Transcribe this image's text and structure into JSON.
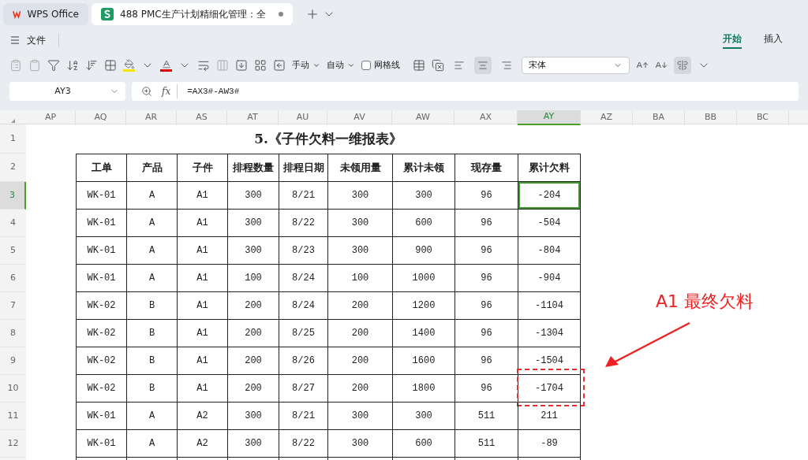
{
  "app_tabs": [
    {
      "label": "WPS Office",
      "kind": "home",
      "selected": false
    },
    {
      "label": "488 PMC生产计划精细化管理：全",
      "kind": "sheet",
      "selected": true,
      "unsaved": true
    }
  ],
  "menu": {
    "file": "文件"
  },
  "ribbon_tabs": [
    {
      "label": "开始",
      "selected": true
    },
    {
      "label": "插入",
      "selected": false
    }
  ],
  "toolbar": {
    "row_height": "手动",
    "col_width": "自动",
    "gridlines": {
      "label": "网格线",
      "checked": false
    },
    "align": [
      {
        "kind": "left",
        "selected": false
      },
      {
        "kind": "center",
        "selected": true
      },
      {
        "kind": "right",
        "selected": false
      }
    ],
    "font": "宋体",
    "vertical_center": {
      "selected": true
    }
  },
  "name_box": "AY3",
  "function_label": "fx",
  "formula": "=AX3#-AW3#",
  "columns": [
    {
      "label": "AP",
      "selected": false
    },
    {
      "label": "AQ",
      "selected": false
    },
    {
      "label": "AR",
      "selected": false
    },
    {
      "label": "AS",
      "selected": false
    },
    {
      "label": "AT",
      "selected": false
    },
    {
      "label": "AU",
      "selected": false
    },
    {
      "label": "AV",
      "selected": false
    },
    {
      "label": "AW",
      "selected": false
    },
    {
      "label": "AX",
      "selected": false
    },
    {
      "label": "AY",
      "selected": true
    },
    {
      "label": "AZ",
      "selected": false
    },
    {
      "label": "BA",
      "selected": false
    },
    {
      "label": "BB",
      "selected": false
    },
    {
      "label": "BC",
      "selected": false
    }
  ],
  "row_numbers": [
    {
      "label": "1",
      "selected": false
    },
    {
      "label": "2",
      "selected": false
    },
    {
      "label": "3",
      "selected": true
    },
    {
      "label": "4",
      "selected": false
    },
    {
      "label": "5",
      "selected": false
    },
    {
      "label": "6",
      "selected": false
    },
    {
      "label": "7",
      "selected": false
    },
    {
      "label": "8",
      "selected": false
    },
    {
      "label": "9",
      "selected": false
    },
    {
      "label": "10",
      "selected": false
    },
    {
      "label": "11",
      "selected": false
    },
    {
      "label": "12",
      "selected": false
    }
  ],
  "title": "5.《子件欠料一维报表》",
  "headers": [
    "工单",
    "产品",
    "子件",
    "排程数量",
    "排程日期",
    "未领用量",
    "累计未领",
    "现存量",
    "累计欠料"
  ],
  "rows": [
    {
      "cells": [
        "WK-01",
        "A",
        "A1",
        "300",
        "8/21",
        "300",
        "300",
        "96"
      ],
      "shortage": {
        "text": "-204",
        "selected": true,
        "marked": false
      }
    },
    {
      "cells": [
        "WK-01",
        "A",
        "A1",
        "300",
        "8/22",
        "300",
        "600",
        "96"
      ],
      "shortage": {
        "text": "-504",
        "selected": false,
        "marked": false
      }
    },
    {
      "cells": [
        "WK-01",
        "A",
        "A1",
        "300",
        "8/23",
        "300",
        "900",
        "96"
      ],
      "shortage": {
        "text": "-804",
        "selected": false,
        "marked": false
      }
    },
    {
      "cells": [
        "WK-01",
        "A",
        "A1",
        "100",
        "8/24",
        "100",
        "1000",
        "96"
      ],
      "shortage": {
        "text": "-904",
        "selected": false,
        "marked": false
      }
    },
    {
      "cells": [
        "WK-02",
        "B",
        "A1",
        "200",
        "8/24",
        "200",
        "1200",
        "96"
      ],
      "shortage": {
        "text": "-1104",
        "selected": false,
        "marked": false
      }
    },
    {
      "cells": [
        "WK-02",
        "B",
        "A1",
        "200",
        "8/25",
        "200",
        "1400",
        "96"
      ],
      "shortage": {
        "text": "-1304",
        "selected": false,
        "marked": false
      }
    },
    {
      "cells": [
        "WK-02",
        "B",
        "A1",
        "200",
        "8/26",
        "200",
        "1600",
        "96"
      ],
      "shortage": {
        "text": "-1504",
        "selected": false,
        "marked": false
      }
    },
    {
      "cells": [
        "WK-02",
        "B",
        "A1",
        "200",
        "8/27",
        "200",
        "1800",
        "96"
      ],
      "shortage": {
        "text": "-1704",
        "selected": false,
        "marked": true
      }
    },
    {
      "cells": [
        "WK-01",
        "A",
        "A2",
        "300",
        "8/21",
        "300",
        "300",
        "511"
      ],
      "shortage": {
        "text": "211",
        "selected": false,
        "marked": false
      }
    },
    {
      "cells": [
        "WK-01",
        "A",
        "A2",
        "300",
        "8/22",
        "300",
        "600",
        "511"
      ],
      "shortage": {
        "text": "-89",
        "selected": false,
        "marked": false
      }
    }
  ],
  "annotation": "A1 最终欠料"
}
